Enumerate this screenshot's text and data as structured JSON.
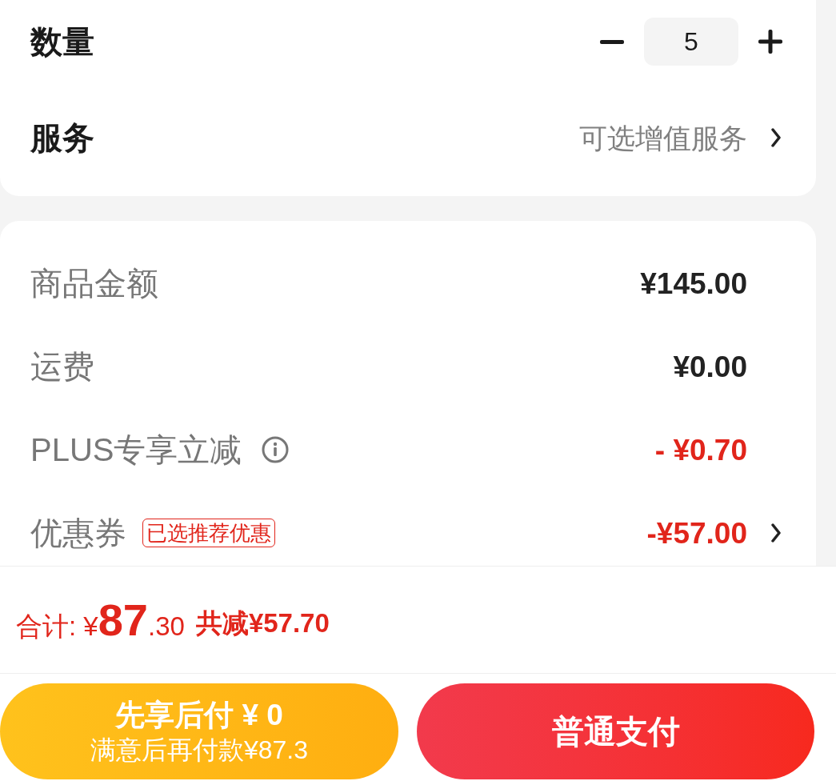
{
  "options_card": {
    "rows": [
      {
        "kind": "stepper",
        "label": "数量",
        "quantity": "5"
      },
      {
        "kind": "link",
        "label": "服务",
        "value": "可选增值服务"
      }
    ]
  },
  "price_card": {
    "rows": [
      {
        "kind": "charge",
        "label": "商品金额",
        "value": "¥145.00",
        "info": false,
        "chevron": false
      },
      {
        "kind": "charge",
        "label": "运费",
        "value": "¥0.00",
        "info": false,
        "chevron": false
      },
      {
        "kind": "discount",
        "label": "PLUS专享立减",
        "value": "- ¥0.70",
        "info": true,
        "chevron": false
      },
      {
        "kind": "discount",
        "label": "优惠券",
        "badge": "已选推荐优惠",
        "value": "-¥57.00",
        "info": false,
        "chevron": true
      }
    ]
  },
  "summary": {
    "total": "合计: ¥**87**.30",
    "saving": "共减¥57.70"
  },
  "buttons": [
    {
      "kind": "pay_later",
      "title": "先享后付 ¥ 0",
      "subtitle": "满意后再付款¥87.3"
    },
    {
      "kind": "pay_now",
      "title": "普通支付"
    }
  ]
}
